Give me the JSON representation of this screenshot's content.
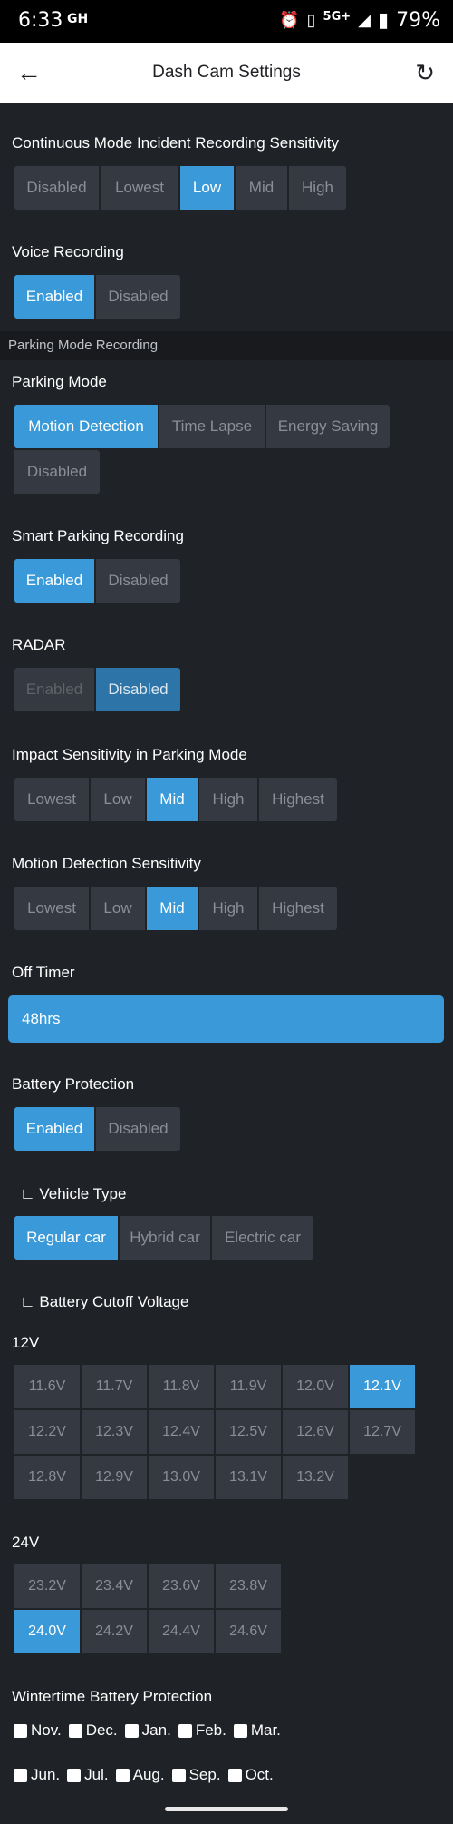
{
  "status": {
    "time": "6:33",
    "carrier": "GH",
    "network": "5G+",
    "battery": "79%"
  },
  "appbar": {
    "title": "Dash Cam Settings"
  },
  "continuous": {
    "label": "Continuous Mode Incident Recording Sensitivity",
    "options": [
      "Disabled",
      "Lowest",
      "Low",
      "Mid",
      "High"
    ],
    "selected": "Low"
  },
  "voice": {
    "label": "Voice Recording",
    "options": [
      "Enabled",
      "Disabled"
    ],
    "selected": "Enabled"
  },
  "parking_section": "Parking Mode Recording",
  "parking_mode": {
    "label": "Parking Mode",
    "options": [
      "Motion Detection",
      "Time Lapse",
      "Energy Saving",
      "Disabled"
    ],
    "selected": "Motion Detection"
  },
  "smart_parking": {
    "label": "Smart Parking Recording",
    "options": [
      "Enabled",
      "Disabled"
    ],
    "selected": "Enabled"
  },
  "radar": {
    "label": "RADAR",
    "options": [
      "Enabled",
      "Disabled"
    ],
    "selected": "Disabled"
  },
  "impact": {
    "label": "Impact Sensitivity in Parking Mode",
    "options": [
      "Lowest",
      "Low",
      "Mid",
      "High",
      "Highest"
    ],
    "selected": "Mid"
  },
  "motion": {
    "label": "Motion Detection Sensitivity",
    "options": [
      "Lowest",
      "Low",
      "Mid",
      "High",
      "Highest"
    ],
    "selected": "Mid"
  },
  "off_timer": {
    "label": "Off Timer",
    "value": "48hrs"
  },
  "battery_protection": {
    "label": "Battery Protection",
    "options": [
      "Enabled",
      "Disabled"
    ],
    "selected": "Enabled"
  },
  "vehicle_type": {
    "label": "Vehicle Type",
    "options": [
      "Regular car",
      "Hybrid car",
      "Electric car"
    ],
    "selected": "Regular car"
  },
  "cutoff": {
    "label": "Battery Cutoff Voltage",
    "v12_label": "12V",
    "v12": [
      "11.6V",
      "11.7V",
      "11.8V",
      "11.9V",
      "12.0V",
      "12.1V",
      "12.2V",
      "12.3V",
      "12.4V",
      "12.5V",
      "12.6V",
      "12.7V",
      "12.8V",
      "12.9V",
      "13.0V",
      "13.1V",
      "13.2V"
    ],
    "v12_selected": "12.1V",
    "v24_label": "24V",
    "v24": [
      "23.2V",
      "23.4V",
      "23.6V",
      "23.8V",
      "24.0V",
      "24.2V",
      "24.4V",
      "24.6V"
    ],
    "v24_selected": "24.0V"
  },
  "wintertime": {
    "label": "Wintertime Battery Protection",
    "months_row1": [
      "Nov.",
      "Dec.",
      "Jan.",
      "Feb.",
      "Mar."
    ],
    "months_row2": [
      "Jun.",
      "Jul.",
      "Aug.",
      "Sep.",
      "Oct."
    ]
  },
  "colors": {
    "accent": "#3a9ad9",
    "button": "#353941",
    "background": "#1f2227"
  },
  "icons": {
    "back": "arrow-left-icon",
    "refresh": "refresh-icon"
  }
}
